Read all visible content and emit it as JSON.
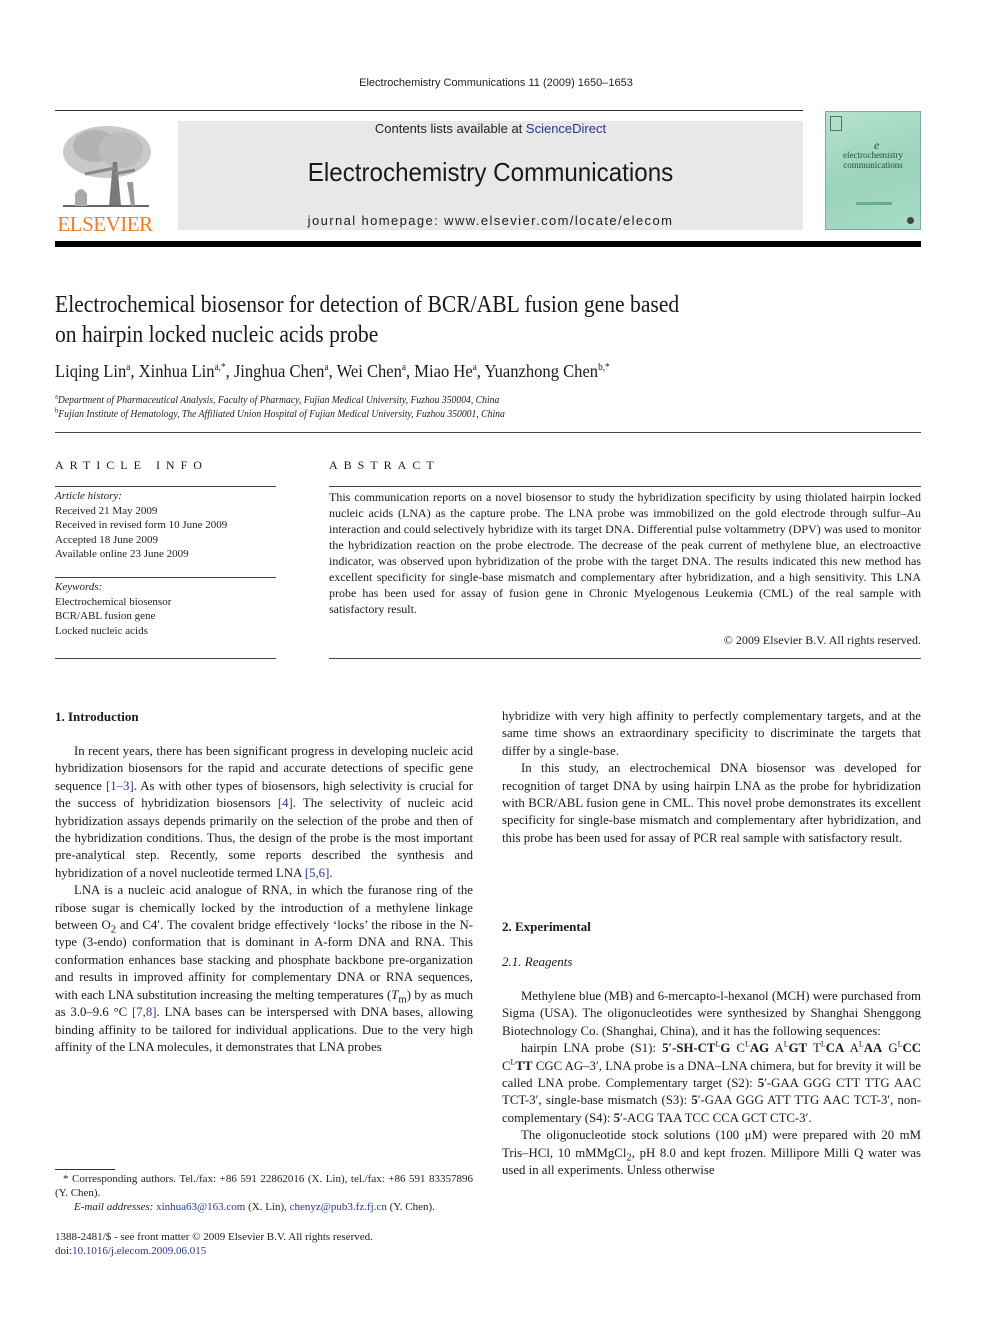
{
  "header": {
    "running_head": "Electrochemistry Communications 11 (2009) 1650–1653",
    "publisher_logo_text": "ELSEVIER",
    "contents_prefix": "Contents lists available at ",
    "contents_link": "ScienceDirect",
    "journal_title": "Electrochemistry Communications",
    "homepage_label": "journal homepage: www.elsevier.com/locate/elecom",
    "cover_line1": "electrochemistry",
    "cover_line2": "communications",
    "colors": {
      "publisher_orange": "#f07c1e",
      "link_blue": "#2a3590",
      "banner_gray": "#e8e8e8",
      "cover_green": "#a9dcc5"
    }
  },
  "article": {
    "title_line1": "Electrochemical biosensor for detection of BCR/ABL fusion gene based",
    "title_line2": "on hairpin locked nucleic acids probe",
    "authors": [
      {
        "name": "Liqing Lin",
        "sup": "a",
        "sep": ", "
      },
      {
        "name": "Xinhua Lin",
        "sup": "a,*",
        "sep": ", "
      },
      {
        "name": "Jinghua Chen",
        "sup": "a",
        "sep": ", "
      },
      {
        "name": "Wei Chen",
        "sup": "a",
        "sep": ", "
      },
      {
        "name": "Miao He",
        "sup": "a",
        "sep": ", "
      },
      {
        "name": "Yuanzhong Chen",
        "sup": "b,*",
        "sep": ""
      }
    ],
    "affiliations": [
      {
        "mark": "a",
        "text": "Department of Pharmaceutical Analysis, Faculty of Pharmacy, Fujian Medical University, Fuzhou 350004, China"
      },
      {
        "mark": "b",
        "text": "Fujian Institute of Hematology, The Affiliated Union Hospital of Fujian Medical University, Fuzhou 350001, China"
      }
    ]
  },
  "article_info": {
    "heading": "ARTICLE INFO",
    "history_label": "Article history:",
    "history": [
      "Received 21 May 2009",
      "Received in revised form 10 June 2009",
      "Accepted 18 June 2009",
      "Available online 23 June 2009"
    ],
    "keywords_label": "Keywords:",
    "keywords": [
      "Electrochemical biosensor",
      "BCR/ABL fusion gene",
      "Locked nucleic acids"
    ]
  },
  "abstract": {
    "heading": "ABSTRACT",
    "text": "This communication reports on a novel biosensor to study the hybridization specificity by using thiolated hairpin locked nucleic acids (LNA) as the capture probe. The LNA probe was immobilized on the gold electrode through sulfur–Au interaction and could selectively hybridize with its target DNA. Differential pulse voltammetry (DPV) was used to monitor the hybridization reaction on the probe electrode. The decrease of the peak current of methylene blue, an electroactive indicator, was observed upon hybridization of the probe with the target DNA. The results indicated this new method has excellent specificity for single-base mismatch and complementary after hybridization, and a high sensitivity. This LNA probe has been used for assay of fusion gene in Chronic Myelogenous Leukemia (CML) of the real sample with satisfactory result.",
    "copyright": "© 2009 Elsevier B.V. All rights reserved."
  },
  "intro": {
    "heading": "1. Introduction",
    "p1": {
      "a": "In recent years, there has been significant progress in developing nucleic acid hybridization biosensors for the rapid and accurate detections of specific gene sequence ",
      "ref1": "[1–3]",
      "b": ". As with other types of biosensors, high selectivity is crucial for the success of hybridization biosensors ",
      "ref2": "[4]",
      "c": ". The selectivity of nucleic acid hybridization assays depends primarily on the selection of the probe and then of the hybridization conditions. Thus, the design of the probe is the most important pre-analytical step. Recently, some reports described the synthesis and hybridization of a novel nucleotide termed LNA ",
      "ref3": "[5,6]",
      "d": "."
    },
    "p2": {
      "a": "LNA is a nucleic acid analogue of RNA, in which the furanose ring of the ribose sugar is chemically locked by the introduction of a methylene linkage between O",
      "a_sub": "2",
      "b": " and C4′. The covalent bridge effectively ‘locks’ the ribose in the N-type (3-endo) conformation that is dominant in A-form DNA and RNA. This conformation enhances base stacking and phosphate backbone pre-organization and results in improved affinity for complementary DNA or RNA sequences, with each LNA substitution increasing the melting temperatures (",
      "tm": "T",
      "tm_sub": "m",
      "c": ") by as much as 3.0–9.6 °C ",
      "ref": "[7,8]",
      "d": ". LNA bases can be interspersed with DNA bases, allowing binding affinity to be tailored for individual applications. Due to the very high affinity of the LNA molecules, it demonstrates that LNA probes"
    },
    "p3": "hybridize with very high affinity to perfectly complementary targets, and at the same time shows an extraordinary specificity to discriminate the targets that differ by a single-base.",
    "p4": "In this study, an electrochemical DNA biosensor was developed for recognition of target DNA by using hairpin LNA as the probe for hybridization with BCR/ABL fusion gene in CML. This novel probe demonstrates its excellent specificity for single-base mismatch and complementary after hybridization, and this probe has been used for assay of PCR real sample with satisfactory result."
  },
  "experimental": {
    "heading": "2. Experimental",
    "sub_heading": "2.1. Reagents",
    "p1": "Methylene blue (MB) and 6-mercapto-l-hexanol (MCH) were purchased from Sigma (USA). The oligonucleotides were synthesized by Shanghai Shenggong Biotechnology Co. (Shanghai, China), and it has the following sequences:",
    "seq": {
      "lead": "hairpin LNA probe (S1): ",
      "s1_parts": [
        {
          "t": "5′-SH-CT",
          "b": true
        },
        {
          "t": "L",
          "sup": true
        },
        {
          "t": "G",
          "b": true
        },
        {
          "t": " C",
          "b": false
        },
        {
          "t": "L",
          "sup": true
        },
        {
          "t": "AG",
          "b": true
        },
        {
          "t": " A",
          "b": false
        },
        {
          "t": "L",
          "sup": true
        },
        {
          "t": "GT",
          "b": true
        },
        {
          "t": " T",
          "b": false
        },
        {
          "t": "L",
          "sup": true
        },
        {
          "t": "CA",
          "b": true
        },
        {
          "t": " A",
          "b": false
        },
        {
          "t": "L",
          "sup": true
        },
        {
          "t": "AA",
          "b": true
        },
        {
          "t": " G",
          "b": false
        },
        {
          "t": "L",
          "sup": true
        },
        {
          "t": "CC",
          "b": true
        },
        {
          "t": " C",
          "b": false
        },
        {
          "t": "L",
          "sup": true
        },
        {
          "t": "TT",
          "b": true
        },
        {
          "t": " CGC AG–3′",
          "b": false
        }
      ],
      "after_s1": ", LNA probe is a DNA–LNA chimera, but for brevity it will be called LNA probe. Complementary target (S2): ",
      "s2_5": "5",
      "s2": "′-GAA GGG CTT TTG AAC TCT-3′, single-base mismatch (S3): ",
      "s3_5": "5",
      "s3": "′-GAA GGG ATT TTG AAC TCT-3′, non-complementary (S4): ",
      "s4_5": "5",
      "s4": "′-ACG TAA TCC CCA GCT CTC-3′."
    },
    "p3": {
      "a": "The oligonucleotide stock solutions (100 μM) were prepared with 20 mM Tris–HCl, 10 mMMgCl",
      "sub": "2",
      "b": ", pH 8.0 and kept frozen. Millipore Milli Q water was used in all experiments. Unless otherwise"
    }
  },
  "footnotes": {
    "corresponding": "* Corresponding authors. Tel./fax: +86 591 22862016 (X. Lin), tel./fax: +86 591 83357896 (Y. Chen).",
    "email_label": "E-mail addresses: ",
    "email1": "xinhua63@163.com",
    "email1_who": " (X. Lin), ",
    "email2": "chenyz@pub3.fz.fj.cn",
    "email2_who": " (Y. Chen).",
    "front_matter": "1388-2481/$ - see front matter © 2009 Elsevier B.V. All rights reserved.",
    "doi_label": "doi:",
    "doi": "10.1016/j.elecom.2009.06.015"
  }
}
